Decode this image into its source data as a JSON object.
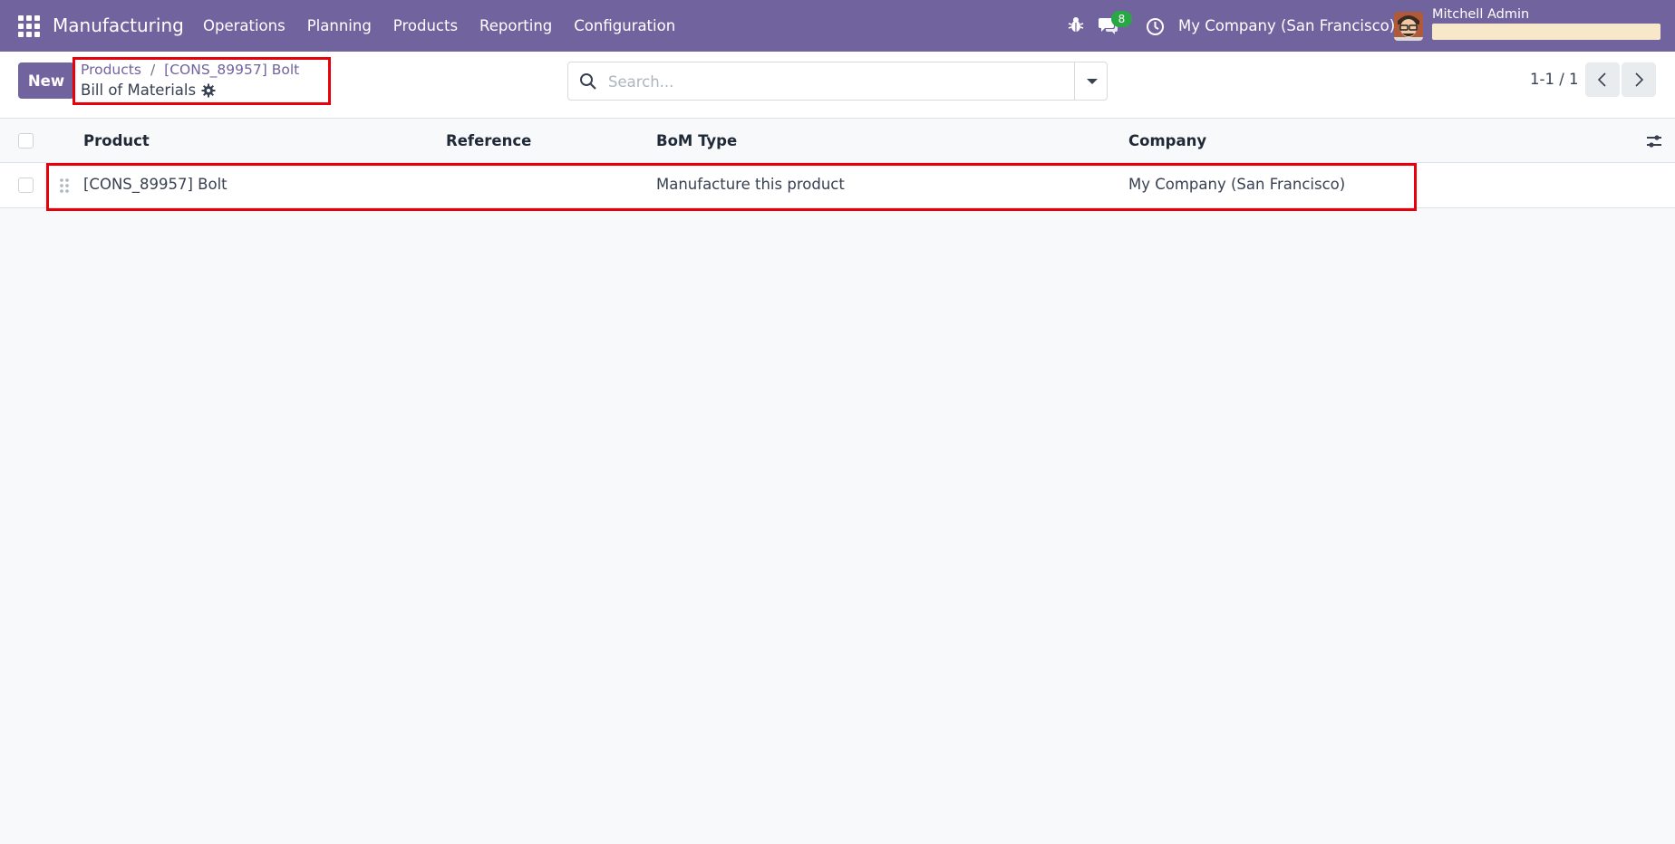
{
  "navbar": {
    "app_title": "Manufacturing",
    "menu": [
      "Operations",
      "Planning",
      "Products",
      "Reporting",
      "Configuration"
    ],
    "chat_count": "8",
    "company": "My Company (San Francisco)",
    "user": "Mitchell Admin"
  },
  "control_panel": {
    "new_label": "New",
    "breadcrumb": [
      "Products",
      "[CONS_89957] Bolt"
    ],
    "current": "Bill of Materials",
    "search_placeholder": "Search...",
    "pager": "1-1 / 1"
  },
  "table": {
    "columns": [
      "Product",
      "Reference",
      "BoM Type",
      "Company"
    ],
    "rows": [
      {
        "product": "[CONS_89957] Bolt",
        "reference": "",
        "bom_type": "Manufacture this product",
        "company": "My Company (San Francisco)"
      }
    ]
  },
  "colors": {
    "brand": "#71639e",
    "highlight": "#e8000b",
    "badge": "#28a745"
  }
}
